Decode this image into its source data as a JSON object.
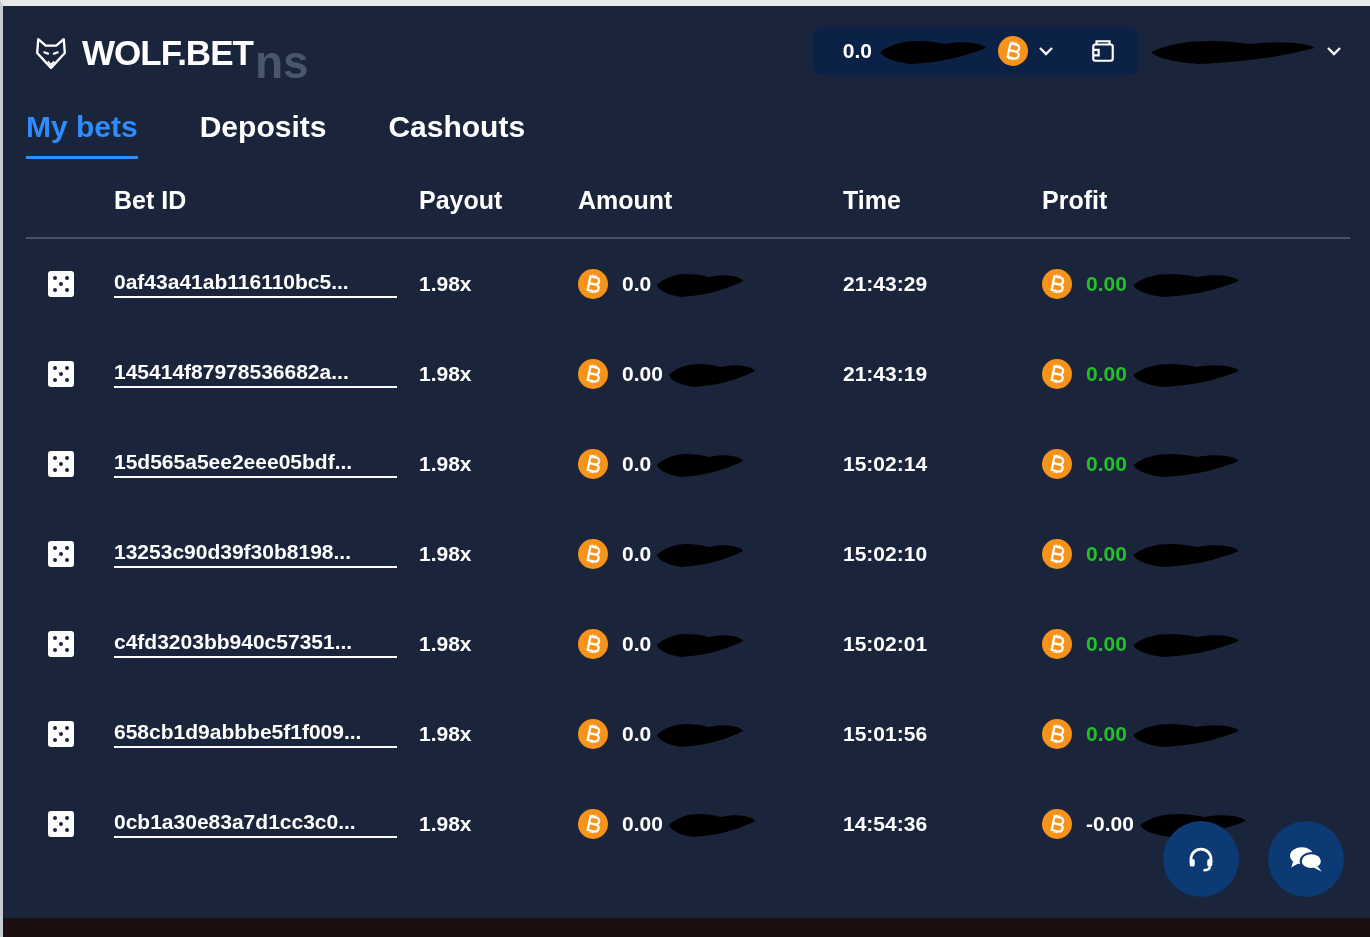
{
  "page": {
    "title": "ns",
    "logo": "WOLF.BET"
  },
  "balance": {
    "amount": "0.0",
    "redacted": true
  },
  "user": {
    "redacted": true
  },
  "tabs": [
    {
      "label": "My bets",
      "selected": true
    },
    {
      "label": "Deposits",
      "selected": false
    },
    {
      "label": "Cashouts",
      "selected": false
    }
  ],
  "table": {
    "columns": [
      "Bet ID",
      "Payout",
      "Amount",
      "Time",
      "Profit"
    ],
    "rows": [
      {
        "bet_id": "0af43a41ab116110bc5...",
        "payout": "1.98x",
        "amount": "0.0",
        "time": "21:43:29",
        "profit": "0.00",
        "positive": true
      },
      {
        "bet_id": "145414f87978536682a...",
        "payout": "1.98x",
        "amount": "0.00",
        "time": "21:43:19",
        "profit": "0.00",
        "positive": true
      },
      {
        "bet_id": "15d565a5ee2eee05bdf...",
        "payout": "1.98x",
        "amount": "0.0",
        "time": "15:02:14",
        "profit": "0.00",
        "positive": true
      },
      {
        "bet_id": "13253c90d39f30b8198...",
        "payout": "1.98x",
        "amount": "0.0",
        "time": "15:02:10",
        "profit": "0.00",
        "positive": true
      },
      {
        "bet_id": "c4fd3203bb940c57351...",
        "payout": "1.98x",
        "amount": "0.0",
        "time": "15:02:01",
        "profit": "0.00",
        "positive": true
      },
      {
        "bet_id": "658cb1d9abbbe5f1f009...",
        "payout": "1.98x",
        "amount": "0.0",
        "time": "15:01:56",
        "profit": "0.00",
        "positive": true
      },
      {
        "bet_id": "0cb1a30e83a7d1cc3c0...",
        "payout": "1.98x",
        "amount": "0.00",
        "time": "14:54:36",
        "profit": "-0.00",
        "positive": false
      }
    ]
  }
}
